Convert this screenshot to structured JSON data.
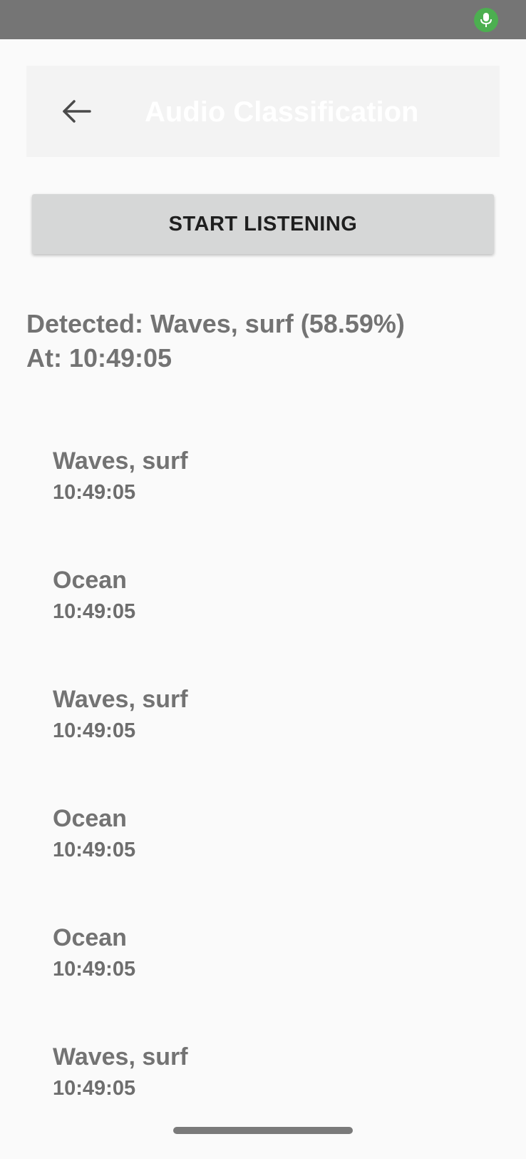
{
  "status_bar": {
    "mic_icon": "microphone-icon",
    "mic_color": "#4caf50"
  },
  "app_bar": {
    "back_icon": "arrow-left-icon",
    "title": "Audio Classification"
  },
  "controls": {
    "start_label": "START LISTENING"
  },
  "detection": {
    "line1": "Detected: Waves, surf (58.59%)",
    "line2": "At: 10:49:05"
  },
  "history": [
    {
      "label": "Waves, surf",
      "time": "10:49:05"
    },
    {
      "label": "Ocean",
      "time": "10:49:05"
    },
    {
      "label": "Waves, surf",
      "time": "10:49:05"
    },
    {
      "label": "Ocean",
      "time": "10:49:05"
    },
    {
      "label": "Ocean",
      "time": "10:49:05"
    },
    {
      "label": "Waves, surf",
      "time": "10:49:05"
    }
  ]
}
